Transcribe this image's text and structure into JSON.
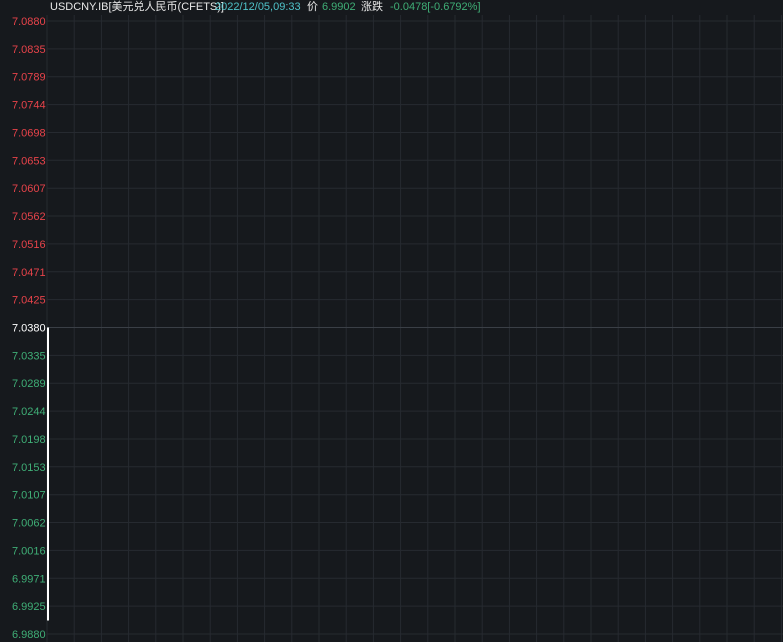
{
  "header": {
    "symbol": "USDCNY.IB[美元兑人民币(CFETS)]",
    "datetime": "2022/12/05,09:33",
    "price_label": "价",
    "price_value": "6.9902",
    "change_label": "涨跌",
    "change_value": "-0.0478[-0.6792%]"
  },
  "colors": {
    "background": "#16191d",
    "grid": "#262a30",
    "up": "#e8434a",
    "down": "#3fae76",
    "baseline": "#ffffff",
    "datetime": "#4fc3c9"
  },
  "chart_data": {
    "type": "line",
    "y_ticks": [
      "7.0880",
      "7.0835",
      "7.0789",
      "7.0744",
      "7.0698",
      "7.0653",
      "7.0607",
      "7.0562",
      "7.0516",
      "7.0471",
      "7.0425",
      "7.0380",
      "7.0335",
      "7.0289",
      "7.0244",
      "7.0198",
      "7.0153",
      "7.0107",
      "7.0062",
      "7.0016",
      "6.9971",
      "6.9925",
      "6.9880"
    ],
    "ylim": [
      6.988,
      7.088
    ],
    "prev_close": 7.038,
    "series": [
      {
        "values": [
          7.038,
          6.9902
        ]
      }
    ],
    "grid": true
  }
}
